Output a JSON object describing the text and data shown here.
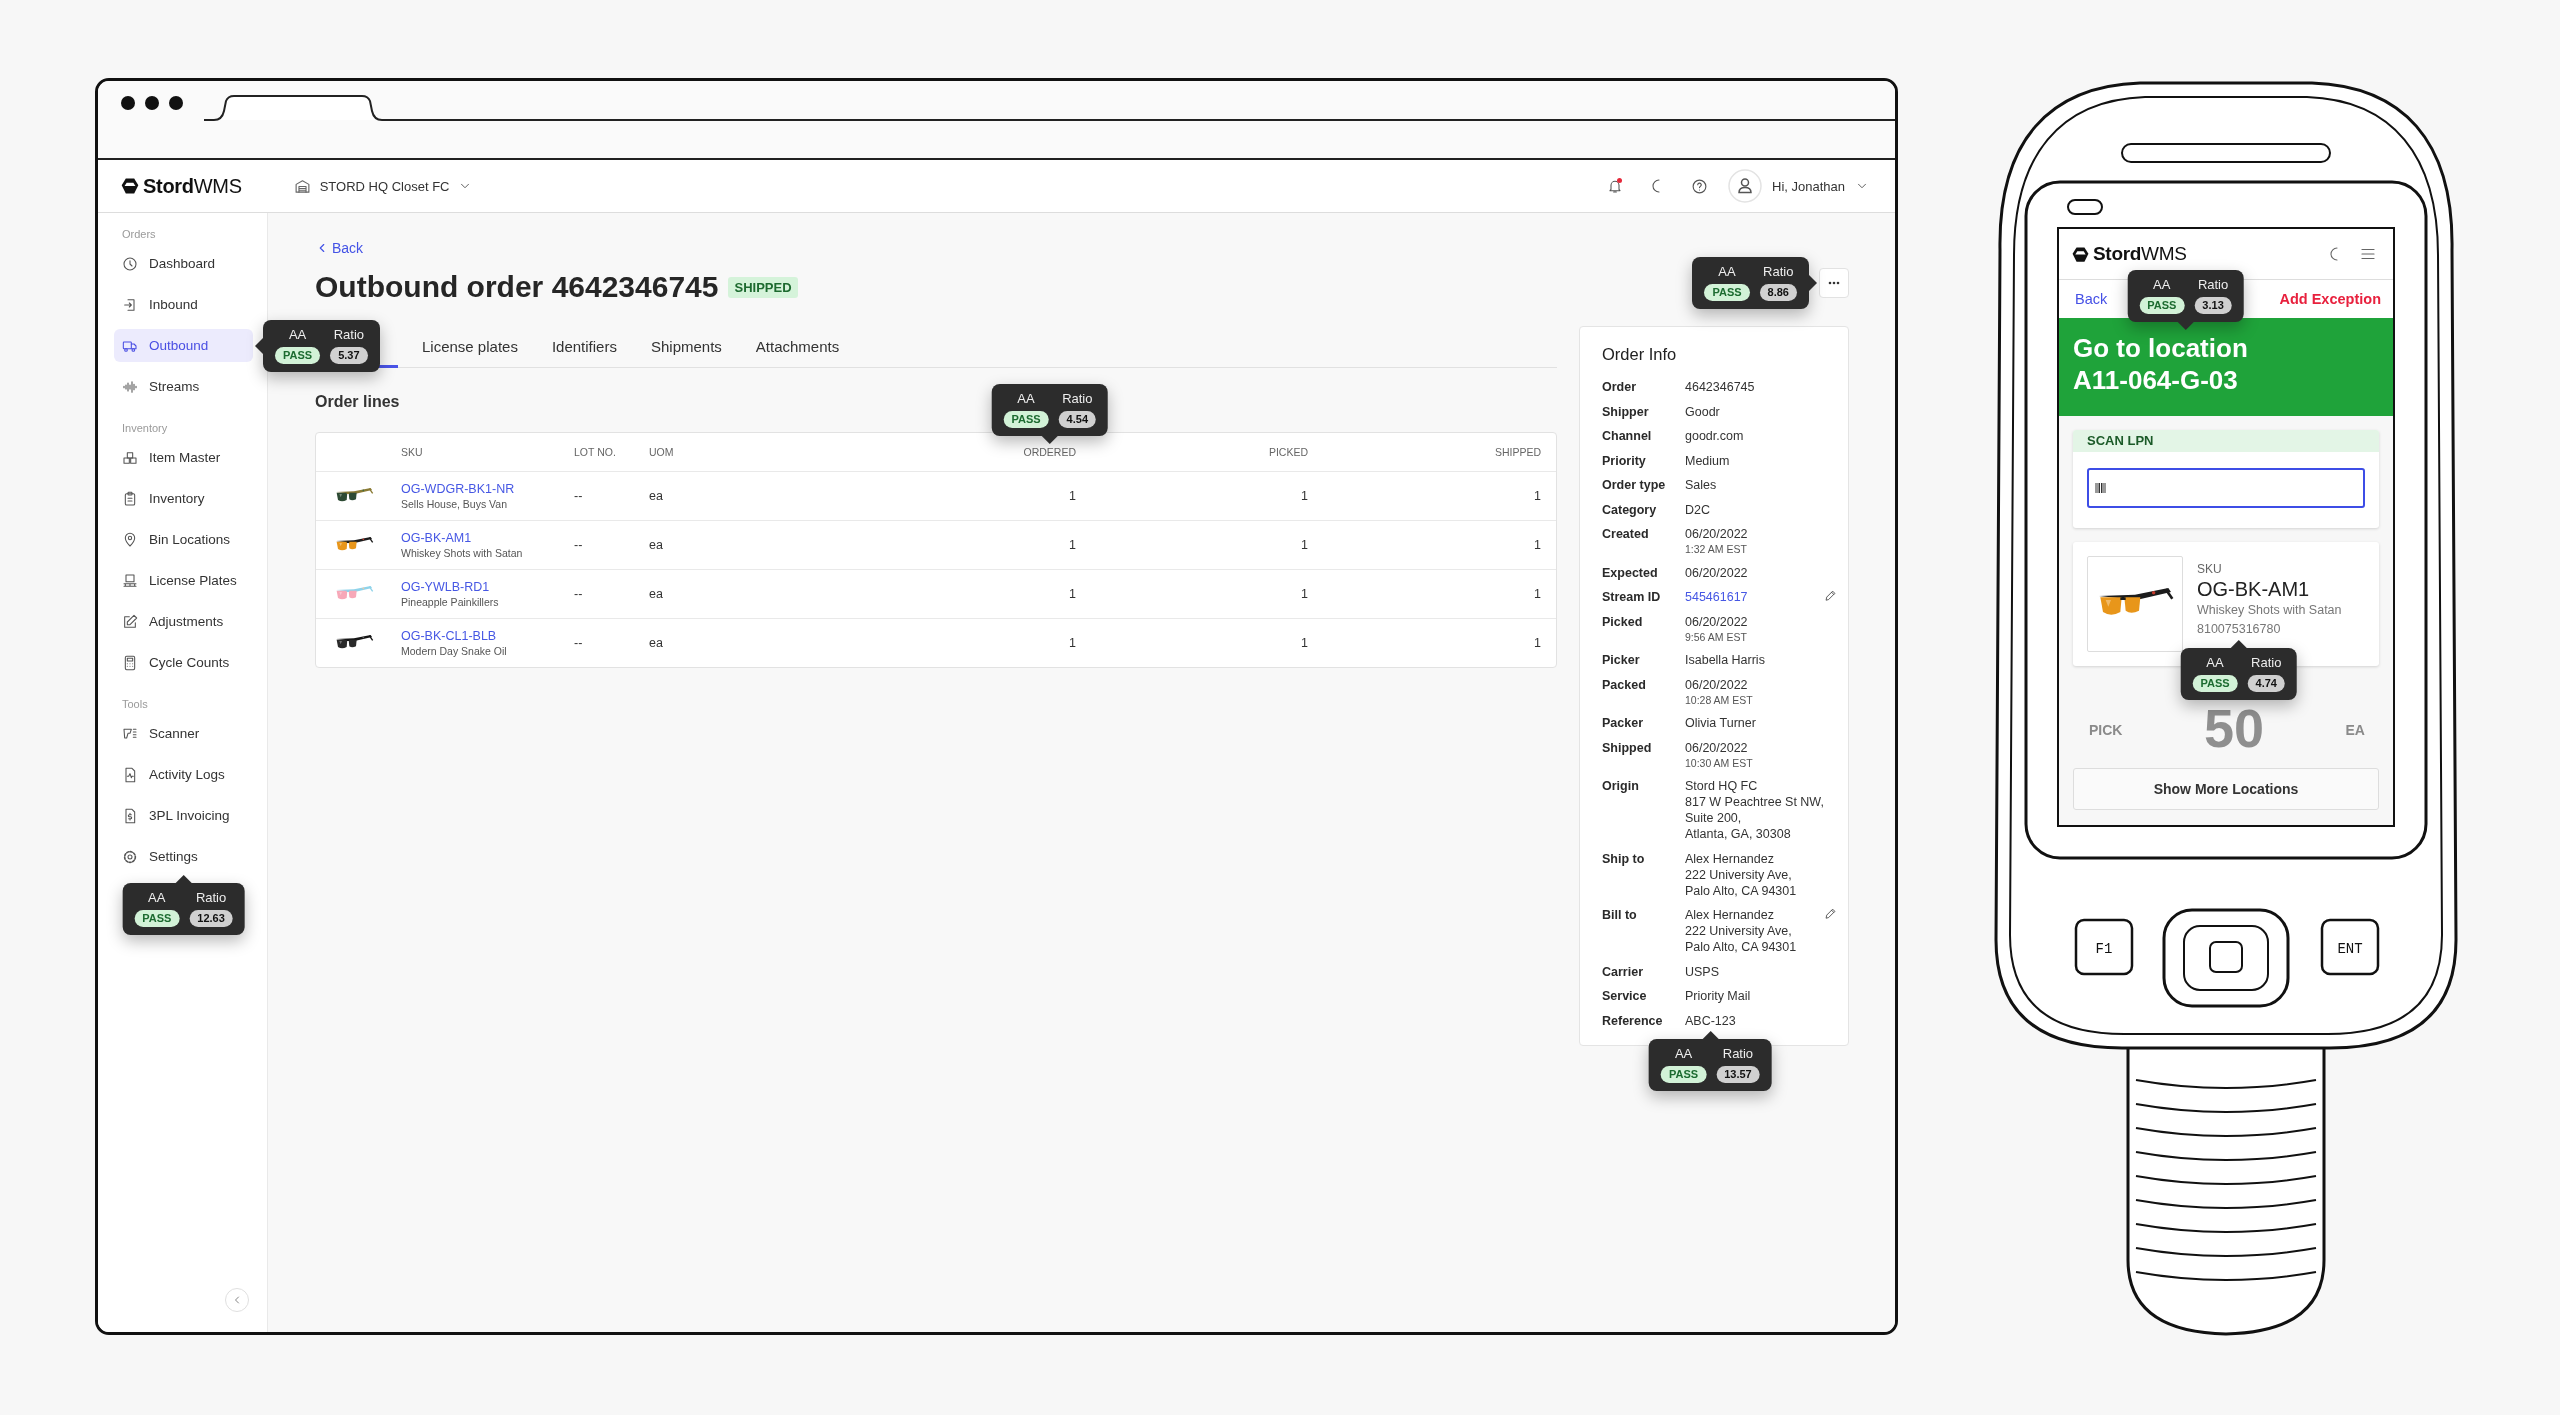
{
  "header": {
    "logo": "**Stord**WMS",
    "facility": "STORD HQ Closet FC",
    "notifications_unread": true,
    "greeting": "Hi, Jonathan"
  },
  "sidebar": {
    "sections": [
      {
        "title": "Orders",
        "items": [
          {
            "label": "Dashboard",
            "selected": false
          },
          {
            "label": "Inbound",
            "selected": false
          },
          {
            "label": "Outbound",
            "selected": true,
            "tooltip": {
              "aa": "AA",
              "ratio_label": "Ratio",
              "result": "PASS",
              "passed": true,
              "ratio": "5.37"
            }
          },
          {
            "label": "Streams",
            "selected": false
          }
        ]
      },
      {
        "title": "Inventory",
        "items": [
          {
            "label": "Item Master",
            "selected": false
          },
          {
            "label": "Inventory",
            "selected": false
          },
          {
            "label": "Bin Locations",
            "selected": false
          },
          {
            "label": "License Plates",
            "selected": false
          },
          {
            "label": "Adjustments",
            "selected": false
          },
          {
            "label": "Cycle Counts",
            "selected": false
          }
        ]
      },
      {
        "title": "Tools",
        "items": [
          {
            "label": "Scanner",
            "selected": false
          },
          {
            "label": "Activity Logs",
            "selected": false
          },
          {
            "label": "3PL Invoicing",
            "selected": false
          },
          {
            "label": "Settings",
            "selected": false,
            "tooltip": {
              "aa": "AA",
              "ratio_label": "Ratio",
              "result": "PASS",
              "passed": true,
              "ratio": "12.63"
            }
          }
        ]
      }
    ]
  },
  "order": {
    "back": "Back",
    "title": "Outbound order 4642346745",
    "status": "SHIPPED",
    "tabs": [
      {
        "selected": true
      },
      {
        "label": "License plates",
        "selected": false
      },
      {
        "label": "Identifiers",
        "selected": false
      },
      {
        "label": "Shipments",
        "selected": false
      },
      {
        "label": "Attachments",
        "selected": false
      }
    ],
    "section_title": "Order lines",
    "table": {
      "columns": [
        {
          "label": "SKU"
        },
        {
          "label": "LOT NO."
        },
        {
          "label": "UOM"
        },
        {
          "label": "ORDERED",
          "tooltip": {
            "aa": "AA",
            "ratio_label": "Ratio",
            "result": "PASS",
            "passed": true,
            "ratio": "4.54"
          }
        },
        {
          "label": "PICKED"
        },
        {
          "label": "SHIPPED"
        }
      ],
      "rows": [
        {
          "sku": "OG-WDGR-BK1-NR",
          "name": "Sells House, Buys Van",
          "lot": "--",
          "uom": "ea",
          "ordered": "1",
          "picked": "1",
          "shipped": "1"
        },
        {
          "sku": "OG-BK-AM1",
          "name": "Whiskey Shots with Satan",
          "lot": "--",
          "uom": "ea",
          "ordered": "1",
          "picked": "1",
          "shipped": "1"
        },
        {
          "sku": "OG-YWLB-RD1",
          "name": "Pineapple Painkillers",
          "lot": "--",
          "uom": "ea",
          "ordered": "1",
          "picked": "1",
          "shipped": "1"
        },
        {
          "sku": "OG-BK-CL1-BLB",
          "name": "Modern Day Snake Oil",
          "lot": "--",
          "uom": "ea",
          "ordered": "1",
          "picked": "1",
          "shipped": "1"
        }
      ]
    }
  },
  "actions_menu": {
    "tooltip": {
      "aa": "AA",
      "ratio_label": "Ratio",
      "result": "PASS",
      "passed": true,
      "ratio": "8.86"
    }
  },
  "order_info": {
    "title": "Order Info",
    "fields": [
      {
        "label": "Order",
        "kind": "text",
        "lines": [
          "4642346745"
        ],
        "editable": false
      },
      {
        "label": "Shipper",
        "kind": "text",
        "lines": [
          "Goodr"
        ],
        "editable": false
      },
      {
        "label": "Channel",
        "kind": "text",
        "lines": [
          "goodr.com"
        ],
        "editable": false
      },
      {
        "label": "Priority",
        "kind": "text",
        "lines": [
          "Medium"
        ],
        "editable": false
      },
      {
        "label": "Order type",
        "kind": "text",
        "lines": [
          "Sales"
        ],
        "editable": false
      },
      {
        "label": "Category",
        "kind": "text",
        "lines": [
          "D2C"
        ],
        "editable": false
      },
      {
        "label": "Created",
        "kind": "text",
        "lines": [
          "06/20/2022"
        ],
        "sub": "1:32 AM EST",
        "editable": false
      },
      {
        "label": "Expected",
        "kind": "text",
        "lines": [
          "06/20/2022"
        ],
        "editable": false
      },
      {
        "label": "Stream ID",
        "kind": "link",
        "lines": [
          "545461617"
        ],
        "editable": true
      },
      {
        "label": "Picked",
        "kind": "text",
        "lines": [
          "06/20/2022"
        ],
        "sub": "9:56 AM EST",
        "editable": false
      },
      {
        "label": "Picker",
        "kind": "text",
        "lines": [
          "Isabella Harris"
        ],
        "editable": false
      },
      {
        "label": "Packed",
        "kind": "text",
        "lines": [
          "06/20/2022"
        ],
        "sub": "10:28 AM EST",
        "editable": false
      },
      {
        "label": "Packer",
        "kind": "text",
        "lines": [
          "Olivia Turner"
        ],
        "editable": false
      },
      {
        "label": "Shipped",
        "kind": "text",
        "lines": [
          "06/20/2022"
        ],
        "sub": "10:30 AM EST",
        "editable": false
      },
      {
        "label": "Origin",
        "kind": "text",
        "lines": [
          "Stord HQ FC",
          "817 W Peachtree St NW,",
          "Suite 200,",
          "Atlanta, GA, 30308"
        ],
        "editable": false
      },
      {
        "label": "Ship to",
        "kind": "text",
        "lines": [
          "Alex Hernandez",
          "222 University Ave,",
          "Palo Alto, CA 94301"
        ],
        "editable": false
      },
      {
        "label": "Bill to",
        "kind": "text",
        "lines": [
          "Alex Hernandez",
          "222 University Ave,",
          "Palo Alto, CA 94301"
        ],
        "editable": true
      },
      {
        "label": "Carrier",
        "kind": "text",
        "lines": [
          "USPS"
        ],
        "editable": false
      },
      {
        "label": "Service",
        "kind": "text",
        "lines": [
          "Priority Mail"
        ],
        "editable": false
      },
      {
        "label": "Reference",
        "kind": "text",
        "lines": [
          "ABC-123"
        ],
        "editable": false,
        "tooltip": {
          "aa": "AA",
          "ratio_label": "Ratio",
          "result": "PASS",
          "passed": true,
          "ratio": "13.57"
        }
      }
    ]
  },
  "scanner": {
    "keys": [
      {
        "label": "F1"
      },
      {
        "label": "ENT"
      }
    ],
    "screen": {
      "logo": "**Stord**WMS",
      "back": "Back",
      "exception": "Add Exception",
      "banner": {
        "text": "Go to location A11-064-G-03",
        "tooltip": {
          "aa": "AA",
          "ratio_label": "Ratio",
          "result": "PASS",
          "passed": true,
          "ratio": "3.13"
        }
      },
      "scan_card": {
        "title": "SCAN LPN"
      },
      "sku_card": {
        "label": "SKU",
        "sku": "OG-BK-AM1",
        "name": "Whiskey Shots with Satan",
        "upc": "810075316780",
        "upc_tooltip": {
          "aa": "AA",
          "ratio_label": "Ratio",
          "result": "PASS",
          "passed": true,
          "ratio": "4.74"
        }
      },
      "pick": {
        "label": "PICK",
        "quantity": "50",
        "unit": "EA"
      },
      "button": "Show More Locations"
    }
  }
}
